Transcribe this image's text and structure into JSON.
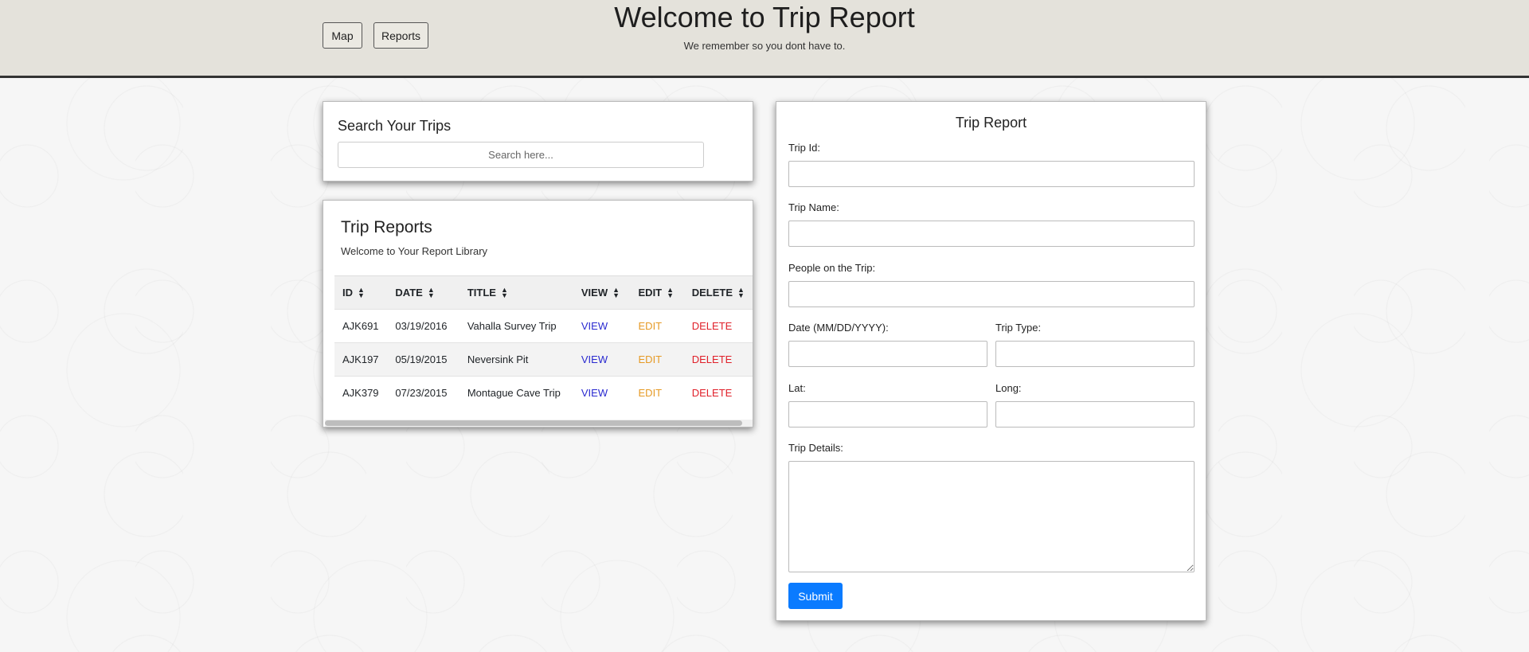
{
  "header": {
    "nav": [
      {
        "label": "Map"
      },
      {
        "label": "Reports"
      }
    ],
    "title": "Welcome to Trip Report",
    "subtitle": "We remember so you dont have to."
  },
  "search": {
    "title": "Search Your Trips",
    "placeholder": "Search here..."
  },
  "reports": {
    "title": "Trip Reports",
    "subtitle": "Welcome to Your Report Library",
    "columns": [
      "ID",
      "DATE",
      "TITLE",
      "VIEW",
      "EDIT",
      "DELETE"
    ],
    "rows": [
      {
        "id": "AJK691",
        "date": "03/19/2016",
        "title": "Vahalla Survey Trip",
        "view": "VIEW",
        "edit": "EDIT",
        "delete": "DELETE"
      },
      {
        "id": "AJK197",
        "date": "05/19/2015",
        "title": "Neversink Pit",
        "view": "VIEW",
        "edit": "EDIT",
        "delete": "DELETE"
      },
      {
        "id": "AJK379",
        "date": "07/23/2015",
        "title": "Montague Cave Trip",
        "view": "VIEW",
        "edit": "EDIT",
        "delete": "DELETE"
      }
    ]
  },
  "form": {
    "title": "Trip Report",
    "labels": {
      "trip_id": "Trip Id:",
      "trip_name": "Trip Name:",
      "people": "People on the Trip:",
      "date": "Date (MM/DD/YYYY):",
      "trip_type": "Trip Type:",
      "lat": "Lat:",
      "long": "Long:",
      "details": "Trip Details:"
    },
    "values": {
      "trip_id": "",
      "trip_name": "",
      "people": "",
      "date": "",
      "trip_type": "",
      "lat": "",
      "long": "",
      "details": ""
    },
    "submit_label": "Submit"
  },
  "colors": {
    "view": "#2a2ad0",
    "edit": "#e69a25",
    "delete": "#e0202a",
    "submit": "#0a7bff"
  }
}
